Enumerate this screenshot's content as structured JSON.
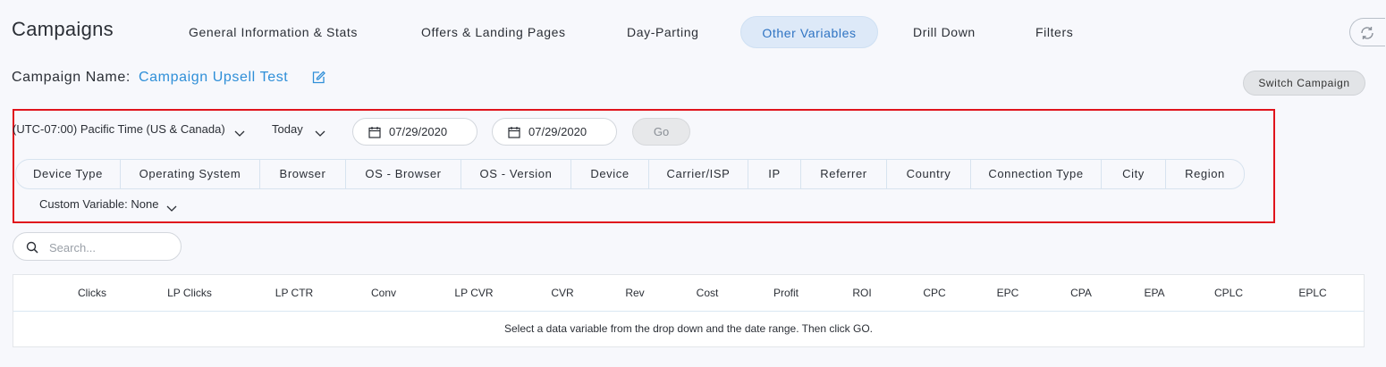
{
  "page": {
    "title": "Campaigns"
  },
  "tabs": [
    {
      "label": "General Information & Stats"
    },
    {
      "label": "Offers & Landing Pages"
    },
    {
      "label": "Day-Parting"
    },
    {
      "label": "Other Variables",
      "active": true
    },
    {
      "label": "Drill Down"
    },
    {
      "label": "Filters"
    }
  ],
  "campaign": {
    "label": "Campaign Name:",
    "name": "Campaign Upsell Test",
    "switch_label": "Switch Campaign"
  },
  "filters": {
    "timezone": "(UTC-07:00) Pacific Time (US & Canada)",
    "period": "Today",
    "start_date": "07/29/2020",
    "end_date": "07/29/2020",
    "go_label": "Go",
    "custom_variable": "Custom Variable: None"
  },
  "variables": [
    "Device Type",
    "Operating System",
    "Browser",
    "OS - Browser",
    "OS - Version",
    "Device",
    "Carrier/ISP",
    "IP",
    "Referrer",
    "Country",
    "Connection Type",
    "City",
    "Region"
  ],
  "search": {
    "placeholder": "Search..."
  },
  "table": {
    "columns": [
      "Clicks",
      "LP Clicks",
      "LP CTR",
      "Conv",
      "LP CVR",
      "CVR",
      "Rev",
      "Cost",
      "Profit",
      "ROI",
      "CPC",
      "EPC",
      "CPA",
      "EPA",
      "CPLC",
      "EPLC"
    ],
    "empty_message": "Select a data variable from the drop down and the date range. Then click GO."
  },
  "colors": {
    "accent": "#2f8fd8",
    "active_tab_bg": "#dde9f8",
    "highlight_border": "#e0141c"
  },
  "icons": {
    "refresh": "refresh-icon",
    "edit": "edit-icon",
    "calendar": "calendar-icon",
    "chevron": "chevron-down-icon",
    "search": "search-icon"
  }
}
